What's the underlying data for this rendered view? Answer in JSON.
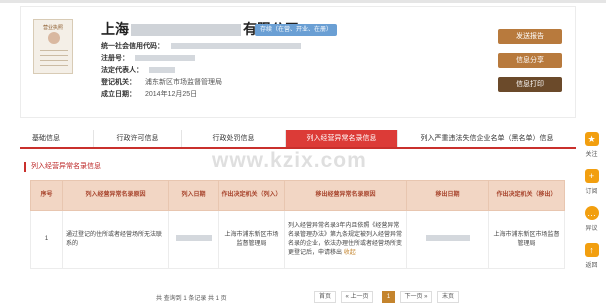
{
  "company": {
    "name_prefix": "上海",
    "name_suffix": "有限公司",
    "status": "存续（在营、开业、在册）",
    "license_title": "营业执照",
    "fields": [
      {
        "label": "统一社会信用代码：",
        "value": ""
      },
      {
        "label": "注册号：",
        "value": ""
      },
      {
        "label": "法定代表人：",
        "value": ""
      },
      {
        "label": "登记机关：",
        "value": "浦东新区市场监督管理局"
      },
      {
        "label": "成立日期：",
        "value": "2014年12月25日"
      }
    ]
  },
  "actions": {
    "send_report": "发送报告",
    "share": "信息分享",
    "print": "信息打印"
  },
  "tabs": [
    "基础信息",
    "行政许可信息",
    "行政处罚信息",
    "列入经营异常名录信息",
    "列入严重违法失信企业名单（黑名单）信息"
  ],
  "active_tab_index": 3,
  "section_title": "列入经营异常名录信息",
  "watermark": "www.kzix.com",
  "table": {
    "headers": [
      "序号",
      "列入经营异常名录原因",
      "列入日期",
      "作出决定机关（列入）",
      "移出经营异常名录原因",
      "移出日期",
      "作出决定机关（移出）"
    ],
    "rows": [
      {
        "index": "1",
        "reason_in": "通过登记的住所或者经营场所无法联系的",
        "date_in": "",
        "authority_in": "上海市浦东新区市场监督管理局",
        "reason_out": "列入经营异常名录3年内且依照《经营异常名录管理办法》第九条规定被列入经营异常名录的企业，依法办理住所或者经营场所变更登记后，申请移出",
        "reason_out_more": "收起",
        "date_out": "",
        "authority_out": "上海市浦东新区市场监督管理局"
      }
    ]
  },
  "pagination": {
    "summary": "共 查询到 1 条记录 共 1 页",
    "first": "首页",
    "prev": "« 上一页",
    "current": "1",
    "next": "下一页 »",
    "last": "末页"
  },
  "float_bar": [
    {
      "label": "关注",
      "icon": "star-icon",
      "glyph": "★",
      "color": "#f29f0f"
    },
    {
      "label": "订阅",
      "icon": "plus-icon",
      "glyph": "+",
      "color": "#f29f0f"
    },
    {
      "label": "异议",
      "icon": "dots-icon",
      "glyph": "…",
      "color": "#f29f0f"
    },
    {
      "label": "返回",
      "icon": "arrow-up-icon",
      "glyph": "↑",
      "color": "#f29f0f"
    }
  ],
  "colors": {
    "accent_red": "#dc3b37",
    "button_brown": "#b87a3d",
    "button_dark": "#6b4a2a",
    "table_header": "#f2d6c4"
  }
}
